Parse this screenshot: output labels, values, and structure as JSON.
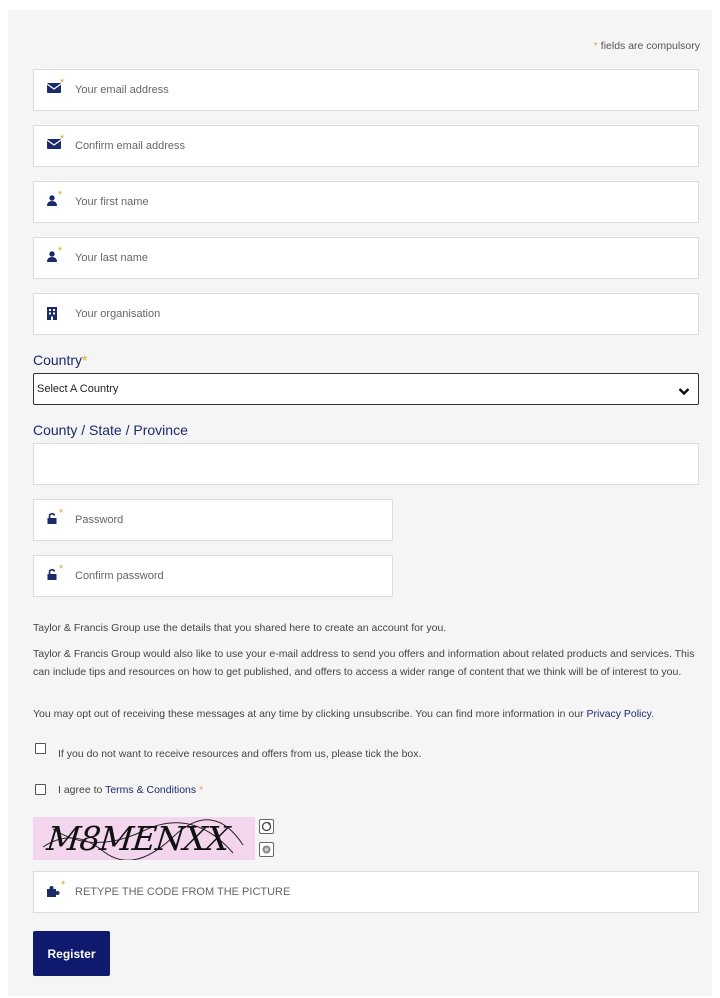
{
  "form": {
    "required_star": "*",
    "required_note": "fields are compulsory",
    "fields": {
      "email": {
        "placeholder": "Your email address",
        "icon": "envelope-icon"
      },
      "confirm_email": {
        "placeholder": "Confirm email address",
        "icon": "envelope-icon"
      },
      "first_name": {
        "placeholder": "Your first name",
        "icon": "user-icon"
      },
      "last_name": {
        "placeholder": "Your last name",
        "icon": "user-icon"
      },
      "organisation": {
        "placeholder": "Your organisation",
        "icon": "building-icon"
      },
      "password": {
        "placeholder": "Password",
        "icon": "lock-icon"
      },
      "confirm_password": {
        "placeholder": "Confirm password",
        "icon": "lock-icon"
      },
      "captcha_input": {
        "placeholder": "RETYPE THE CODE FROM THE PICTURE",
        "icon": "puzzle-icon"
      }
    },
    "country_label": "Country",
    "country_selected": "Select A Country",
    "region_label": "County / State / Province",
    "region_value": "",
    "consent_text_1": "Taylor & Francis Group use the details that you shared here to create an account for you.",
    "consent_text_2": "Taylor & Francis Group would also like to use your e-mail address to send you offers and information about related products and services. This can include tips and resources on how to get published, and offers to access a wider range of content that we think will be of interest to you.",
    "consent_text_3_prefix": "You may opt out of receiving these messages at any time by clicking unsubscribe. You can find more information in our ",
    "privacy_link": "Privacy Policy",
    "consent_text_3_suffix": ".",
    "optout_checkbox_label": "If you do not want to receive resources and offers from us, please tick the box.",
    "terms_prefix": "I agree to ",
    "terms_link": "Terms & Conditions",
    "captcha_code": "M8MENXX",
    "register_button": "Register",
    "colors": {
      "accent": "#e8a33d",
      "brand": "#0f1a6e",
      "label": "#1b2a6b",
      "captcha_bg": "#f3d6ee"
    }
  }
}
